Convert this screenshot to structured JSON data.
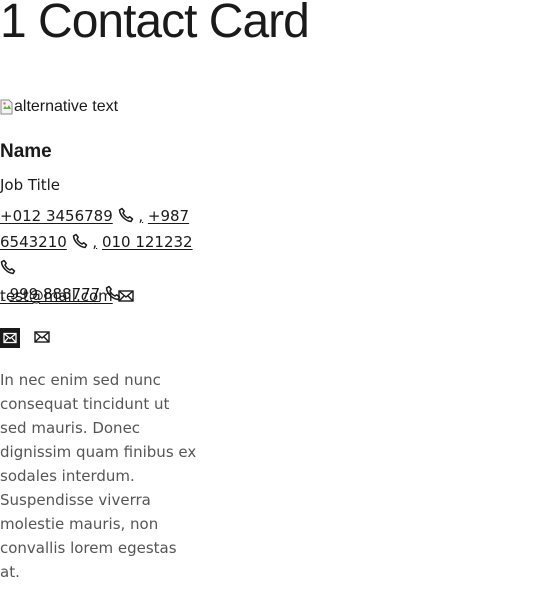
{
  "page": {
    "title": "1 Contact Card"
  },
  "card": {
    "image_alt": "alternative text",
    "name": "Name",
    "job_title": "Job Title",
    "phones": [
      {
        "line1": "+012 3456789"
      },
      {
        "line1": "+987",
        "line2": "6543210"
      },
      {
        "line1": "010 121232"
      },
      {
        "line1": "999 888777"
      }
    ],
    "separator": ",",
    "email": "test@mail.com",
    "bio": "In nec enim sed nunc consequat tincidunt ut sed mauris. Donec dignissim quam finibus ex sodales interdum. Suspendisse viverra molestie mauris, non convallis lorem egestas at."
  },
  "icons": {
    "phone": "phone-icon",
    "email": "envelope-icon",
    "broken_image": "broken-image-icon"
  }
}
